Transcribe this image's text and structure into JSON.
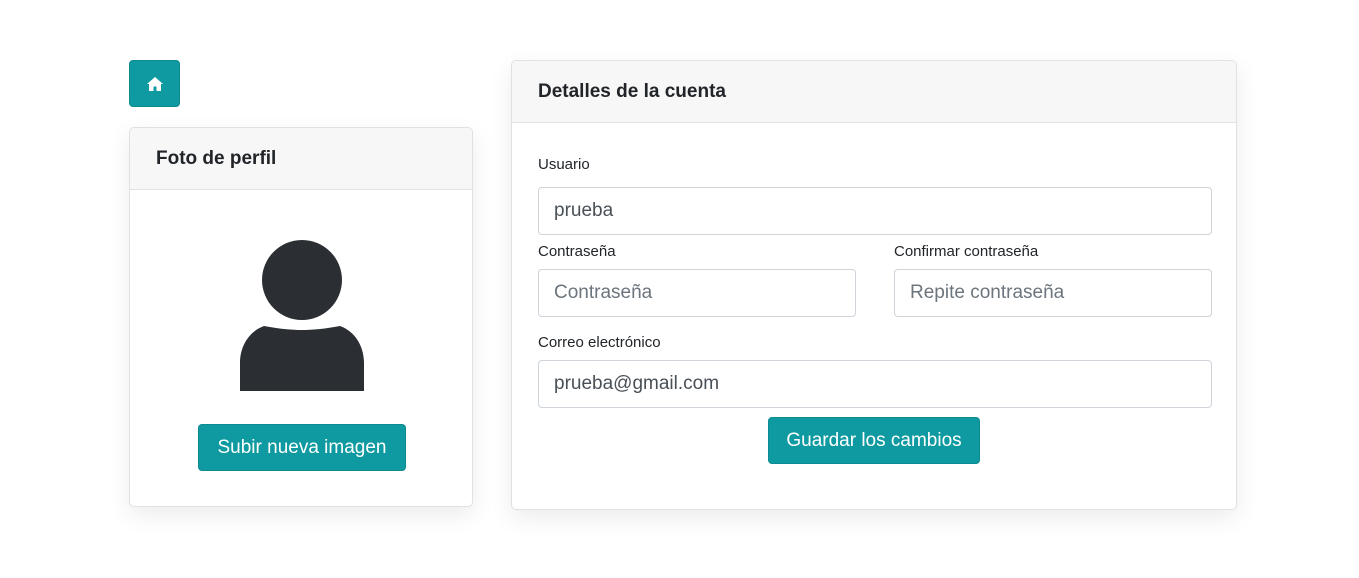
{
  "colors": {
    "accent": "#0e9aa0",
    "avatar": "#2b2f33",
    "card_header_bg": "#f7f7f7"
  },
  "nav": {
    "home_icon": "home-icon"
  },
  "profile_card": {
    "title": "Foto de perfil",
    "avatar_icon": "user-silhouette-icon",
    "upload_label": "Subir nueva imagen"
  },
  "account_card": {
    "title": "Detalles de la cuenta",
    "username": {
      "label": "Usuario",
      "value": "prueba"
    },
    "password": {
      "label": "Contraseña",
      "placeholder": "Contraseña",
      "value": ""
    },
    "confirm_password": {
      "label": "Confirmar contraseña",
      "placeholder": "Repite contraseña",
      "value": ""
    },
    "email": {
      "label": "Correo electrónico",
      "value": "prueba@gmail.com"
    },
    "save_label": "Guardar los cambios"
  }
}
